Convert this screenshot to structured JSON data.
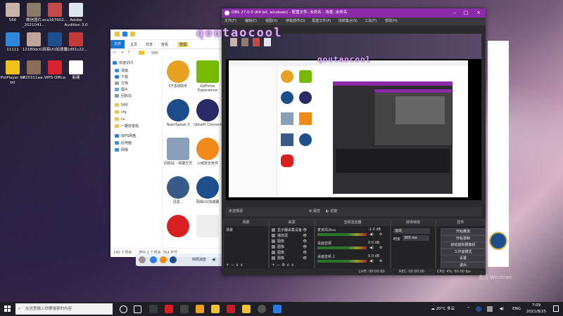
{
  "desktop": {
    "icons": [
      {
        "label": "566",
        "icon": "user-photo-icon",
        "color": "#c9b4a8"
      },
      {
        "label": "微信图片_2021041...",
        "icon": "image-file-icon",
        "color": "#8c7a6a"
      },
      {
        "label": "eca167602...",
        "icon": "image-file-icon",
        "color": "#c24a4a"
      },
      {
        "label": "Adobe Audition 3.0",
        "icon": "audition-icon",
        "color": "#dfe6f0"
      },
      {
        "label": "11111",
        "icon": "doc-icon",
        "color": "#2e88d9"
      },
      {
        "label": "12180dc0...",
        "icon": "image-file-icon",
        "color": "#bfa59a"
      },
      {
        "label": "网易UU加速器",
        "icon": "uu-booster-icon",
        "color": "#1f4e8c"
      },
      {
        "label": "01d91c22...",
        "icon": "image-file-icon",
        "color": "#c23a3a"
      },
      {
        "label": "PotPlayer 64 bit",
        "icon": "potplayer-icon",
        "color": "#f0c21a"
      },
      {
        "label": "df20311aa...",
        "icon": "image-file-icon",
        "color": "#8a6e5c"
      },
      {
        "label": "WPS Office",
        "icon": "wps-office-icon",
        "color": "#d8242f"
      },
      {
        "label": "新建",
        "icon": "new-file-icon",
        "color": "#ffffff"
      }
    ]
  },
  "explorer": {
    "ribbon_tabs": [
      "文件",
      "主页",
      "共享",
      "查看",
      "管理"
    ],
    "ribbon_highlight": "应用程序工具",
    "address": "566",
    "nav_items": [
      {
        "label": "快速访问",
        "color": "#2a7be4"
      },
      {
        "label": "桌面",
        "color": "#3b8ee8"
      },
      {
        "label": "下载",
        "color": "#2a7be4"
      },
      {
        "label": "文档",
        "color": "#9aa4b0"
      },
      {
        "label": "图片",
        "color": "#5ea2e8"
      },
      {
        "label": "回收站",
        "color": "#8a98a8"
      },
      {
        "label": "566",
        "color": "#f0c24a"
      },
      {
        "label": "cfg",
        "color": "#f0c24a"
      },
      {
        "label": "cs",
        "color": "#f0c24a"
      },
      {
        "label": "一鞭抢答题",
        "color": "#f0c24a"
      },
      {
        "label": "WPS网盘",
        "color": "#2a7be4"
      },
      {
        "label": "此电脑",
        "color": "#3b8ee8"
      },
      {
        "label": "网络",
        "color": "#3b8ee8"
      }
    ],
    "files": [
      {
        "label": "CF活动助手",
        "icon": "cf-icon",
        "color": "#e8a020"
      },
      {
        "label": "GeForce Experience",
        "icon": "nvidia-icon",
        "color": "#76b900"
      },
      {
        "label": "TeamSpeak 3",
        "icon": "teamspeak-icon",
        "color": "#1e4d8c"
      },
      {
        "label": "Ubisoft Connect",
        "icon": "ubisoft-icon",
        "color": "#2a2a66"
      },
      {
        "label": "回收站 - 快捷方式",
        "icon": "recycle-bin-icon",
        "color": "#8aa0b8"
      },
      {
        "label": "火绒安全软件",
        "icon": "huorong-icon",
        "color": "#f08a1a"
      },
      {
        "label": "迅雷...",
        "icon": "xunlei-icon",
        "color": "#3a5a8a"
      },
      {
        "label": "网易UU加速器",
        "icon": "uu-booster-icon",
        "color": "#1f4e8c"
      },
      {
        "label": "",
        "icon": "among-us-icon",
        "color": "#d92020"
      },
      {
        "label": "",
        "icon": "blank-file-icon",
        "color": "#eeeeee"
      }
    ],
    "status_count": "140 个项目",
    "status_selected": "选中 1 个项目",
    "status_size": "764 字节"
  },
  "mini_taskbar": {
    "label": "四周消音"
  },
  "obs": {
    "title": "OBS 27.0.0 (64-bit, windows) - 配置文件: 未命名 - 场景: 未命名",
    "menu": [
      "文件(F)",
      "编辑(E)",
      "视图(V)",
      "停靠部件(D)",
      "配置文件(P)",
      "场景集合(S)",
      "工具(T)",
      "帮助(H)"
    ],
    "watermark": "qoutaocool",
    "toolbar_left": "未选择源",
    "toolbar_props": "属性",
    "toolbar_filters": "滤镜",
    "docks": {
      "scenes": {
        "title": "场景",
        "items": [
          "场景"
        ]
      },
      "sources": {
        "title": "来源",
        "items": [
          "显示器采集设备",
          "播放源",
          "图像",
          "图像",
          "图像",
          "图像"
        ]
      },
      "mixer": {
        "title": "音频混音器",
        "tracks": [
          {
            "name": "麦克风/Aux",
            "db": "-1.0 dB"
          },
          {
            "name": "桌面音频",
            "db": "0.0 dB"
          },
          {
            "name": "桌面音频 2",
            "db": "0.0 dB"
          }
        ]
      },
      "transitions": {
        "title": "转场特效",
        "type": "淡出",
        "duration_label": "时长",
        "duration_value": "300 ms"
      },
      "controls": {
        "title": "控件",
        "buttons": [
          "开始推流",
          "开始录制",
          "启动虚拟摄像机",
          "工作室模式",
          "设置",
          "退出"
        ]
      }
    },
    "status": {
      "live": "LIVE: 00:00:00",
      "rec": "REC: 00:00:00",
      "cpu": "CPU: 4%, 60.00 fps"
    }
  },
  "windows_watermark": "激活 Windows",
  "taskbar": {
    "search_placeholder": "在这里输入你要搜索的内容",
    "weather": "20°C 多云",
    "lang": "ENG",
    "time": "7:09",
    "date": "2021/8/25"
  }
}
